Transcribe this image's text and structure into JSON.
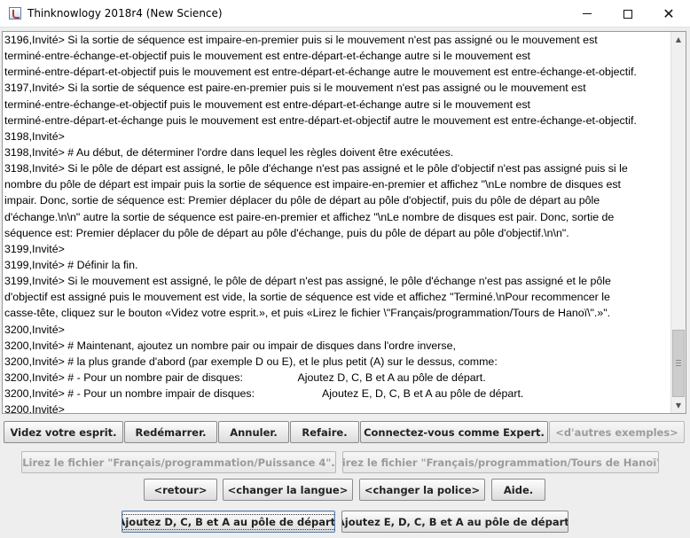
{
  "window": {
    "title": "Thinknowlogy 2018r4 (New Science)",
    "close_glyph": "✕",
    "icon": "java-cup-icon"
  },
  "output_lines": [
    "3196,Invité> Si la sortie de séquence est impaire-en-premier puis si le mouvement n'est pas assigné ou le mouvement est",
    "terminé-entre-échange-et-objectif puis le mouvement est entre-départ-et-échange autre si le mouvement est",
    "terminé-entre-départ-et-objectif puis le mouvement est entre-départ-et-échange autre le mouvement est entre-échange-et-objectif.",
    "3197,Invité> Si la sortie de séquence est paire-en-premier puis si le mouvement n'est pas assigné ou le mouvement est",
    "terminé-entre-échange-et-objectif puis le mouvement est entre-départ-et-échange autre si le mouvement est",
    "terminé-entre-départ-et-échange puis le mouvement est entre-départ-et-objectif autre le mouvement est entre-échange-et-objectif.",
    "3198,Invité>",
    "3198,Invité> # Au début, de déterminer l'ordre dans lequel les règles doivent être exécutées.",
    "3198,Invité> Si le pôle de départ est assigné, le pôle d'échange n'est pas assigné et le pôle d'objectif n'est pas assigné puis si le",
    "nombre du pôle de départ est impair puis la sortie de séquence est impaire-en-premier et affichez \"\\nLe nombre de disques est",
    "impair. Donc, sortie de séquence est: Premier déplacer du pôle de départ au pôle d'objectif, puis du pôle de départ au pôle",
    "d'échange.\\n\\n\" autre la sortie de séquence est paire-en-premier et affichez \"\\nLe nombre de disques est pair. Donc, sortie de",
    "séquence est: Premier déplacer du pôle de départ au pôle d'échange, puis du pôle de départ au pôle d'objectif.\\n\\n\".",
    "3199,Invité>",
    "3199,Invité> # Définir la fin.",
    "3199,Invité> Si le mouvement est assigné, le pôle de départ n'est pas assigné, le pôle d'échange n'est pas assigné et le pôle",
    "d'objectif est assigné puis le mouvement est vide, la sortie de séquence est vide et affichez \"Terminé.\\nPour recommencer le",
    "casse-tête, cliquez sur le bouton «Videz votre esprit.», et puis «Lirez le fichier \\\"Français/programmation/Tours de Hanoï\\\".»\".",
    "3200,Invité>",
    "3200,Invité> # Maintenant, ajoutez un nombre pair ou impair de disques dans l'ordre inverse,",
    "3200,Invité> # la plus grande d'abord (par exemple D ou E), et le plus petit (A) sur le dessus, comme:",
    "3200,Invité> # - Pour un nombre pair de disques:\t\t\tAjoutez D, C, B et A au pôle de départ.",
    "3200,Invité> # - Pour un nombre impair de disques:\t\t\tAjoutez E, D, C, B et A au pôle de départ.",
    "3200,Invité>"
  ],
  "row1": {
    "clear_mind": "Videz votre esprit.",
    "restart": "Redémarrer.",
    "undo": "Annuler.",
    "redo": "Refaire.",
    "login_expert": "Connectez-vous comme Expert.",
    "other_examples": "<d'autres exemples>"
  },
  "row2": {
    "read_power4": "Lirez le fichier \"Français/programmation/Puissance 4\".",
    "read_hanoi": "Lirez le fichier \"Français/programmation/Tours de Hanoï\"."
  },
  "row3": {
    "back": "<retour>",
    "change_language": "<changer la langue>",
    "change_font": "<changer la police>",
    "help": "Aide."
  },
  "row4": {
    "add_dcba": "Ajoutez D, C, B et A au pôle de départ.",
    "add_edcba": "Ajoutez E, D, C, B et A au pôle de départ."
  }
}
